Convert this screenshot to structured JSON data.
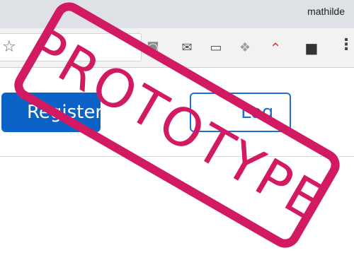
{
  "browser": {
    "profile_name": "mathilde",
    "bookmark_icon": "star-icon",
    "extensions": [
      {
        "name": "camera-icon",
        "glyph": "◙",
        "color": "#7a7a7a"
      },
      {
        "name": "inbox-icon",
        "glyph": "✉",
        "color": "#555555"
      },
      {
        "name": "cast-icon",
        "glyph": "▭",
        "color": "#555555"
      },
      {
        "name": "dropbox-icon",
        "glyph": "❖",
        "color": "#9aa0a6"
      },
      {
        "name": "analytics-icon",
        "glyph": "⌃",
        "color": "#d44"
      },
      {
        "name": "app-icon",
        "glyph": "■",
        "color": "#333333"
      }
    ],
    "menu_icon": "more-vert-icon"
  },
  "page": {
    "register_label": "Register",
    "login_label": "Log in"
  },
  "stamp": {
    "text": "PROTOTYPE",
    "color": "#d21a63"
  }
}
